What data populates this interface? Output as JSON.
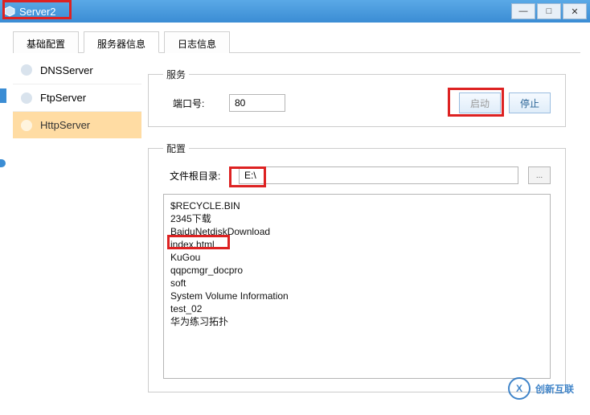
{
  "window": {
    "title": "Server2",
    "min": "—",
    "max": "□",
    "close": "✕"
  },
  "tabs": [
    {
      "label": "基础配置"
    },
    {
      "label": "服务器信息"
    },
    {
      "label": "日志信息"
    }
  ],
  "sidebar": {
    "items": [
      {
        "label": "DNSServer"
      },
      {
        "label": "FtpServer"
      },
      {
        "label": "HttpServer"
      }
    ]
  },
  "service": {
    "legend": "服务",
    "port_label": "端口号:",
    "port_value": "80",
    "start_label": "启动",
    "stop_label": "停止"
  },
  "config": {
    "legend": "配置",
    "root_label": "文件根目录:",
    "root_value": "E:\\",
    "browse": "...",
    "files": [
      "$RECYCLE.BIN",
      "2345下载",
      "BaiduNetdiskDownload",
      "index.html",
      "KuGou",
      "qqpcmgr_docpro",
      "soft",
      "System Volume Information",
      "test_02",
      "华为练习拓扑"
    ]
  },
  "logo": {
    "mark": "X",
    "text": "创新互联"
  }
}
